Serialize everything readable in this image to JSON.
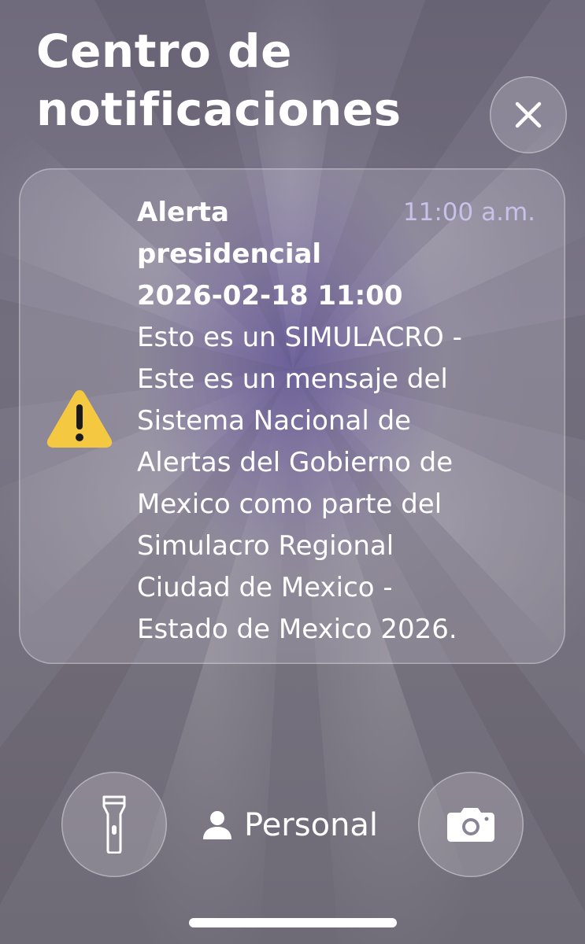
{
  "header": {
    "title": "Centro de notificaciones"
  },
  "notification": {
    "title_lines": [
      "Alerta",
      "presidencial"
    ],
    "datetime": "2026-02-18 11:00",
    "time": "11:00 a.m.",
    "body_lines": [
      "Esto es un SIMULACRO -",
      "Este es un mensaje del",
      "Sistema Nacional de",
      "Alertas del Gobierno de",
      "Mexico como parte del",
      "Simulacro Regional",
      "Ciudad de Mexico -",
      "Estado de Mexico 2026."
    ],
    "icon": "warning-icon"
  },
  "controls": {
    "close_icon": "close-icon",
    "flashlight_icon": "flashlight-icon",
    "camera_icon": "camera-icon",
    "focus_icon": "person-icon",
    "focus_label": "Personal"
  },
  "colors": {
    "warning_fill": "#f5c842",
    "time_text": "#c7c2e8"
  }
}
